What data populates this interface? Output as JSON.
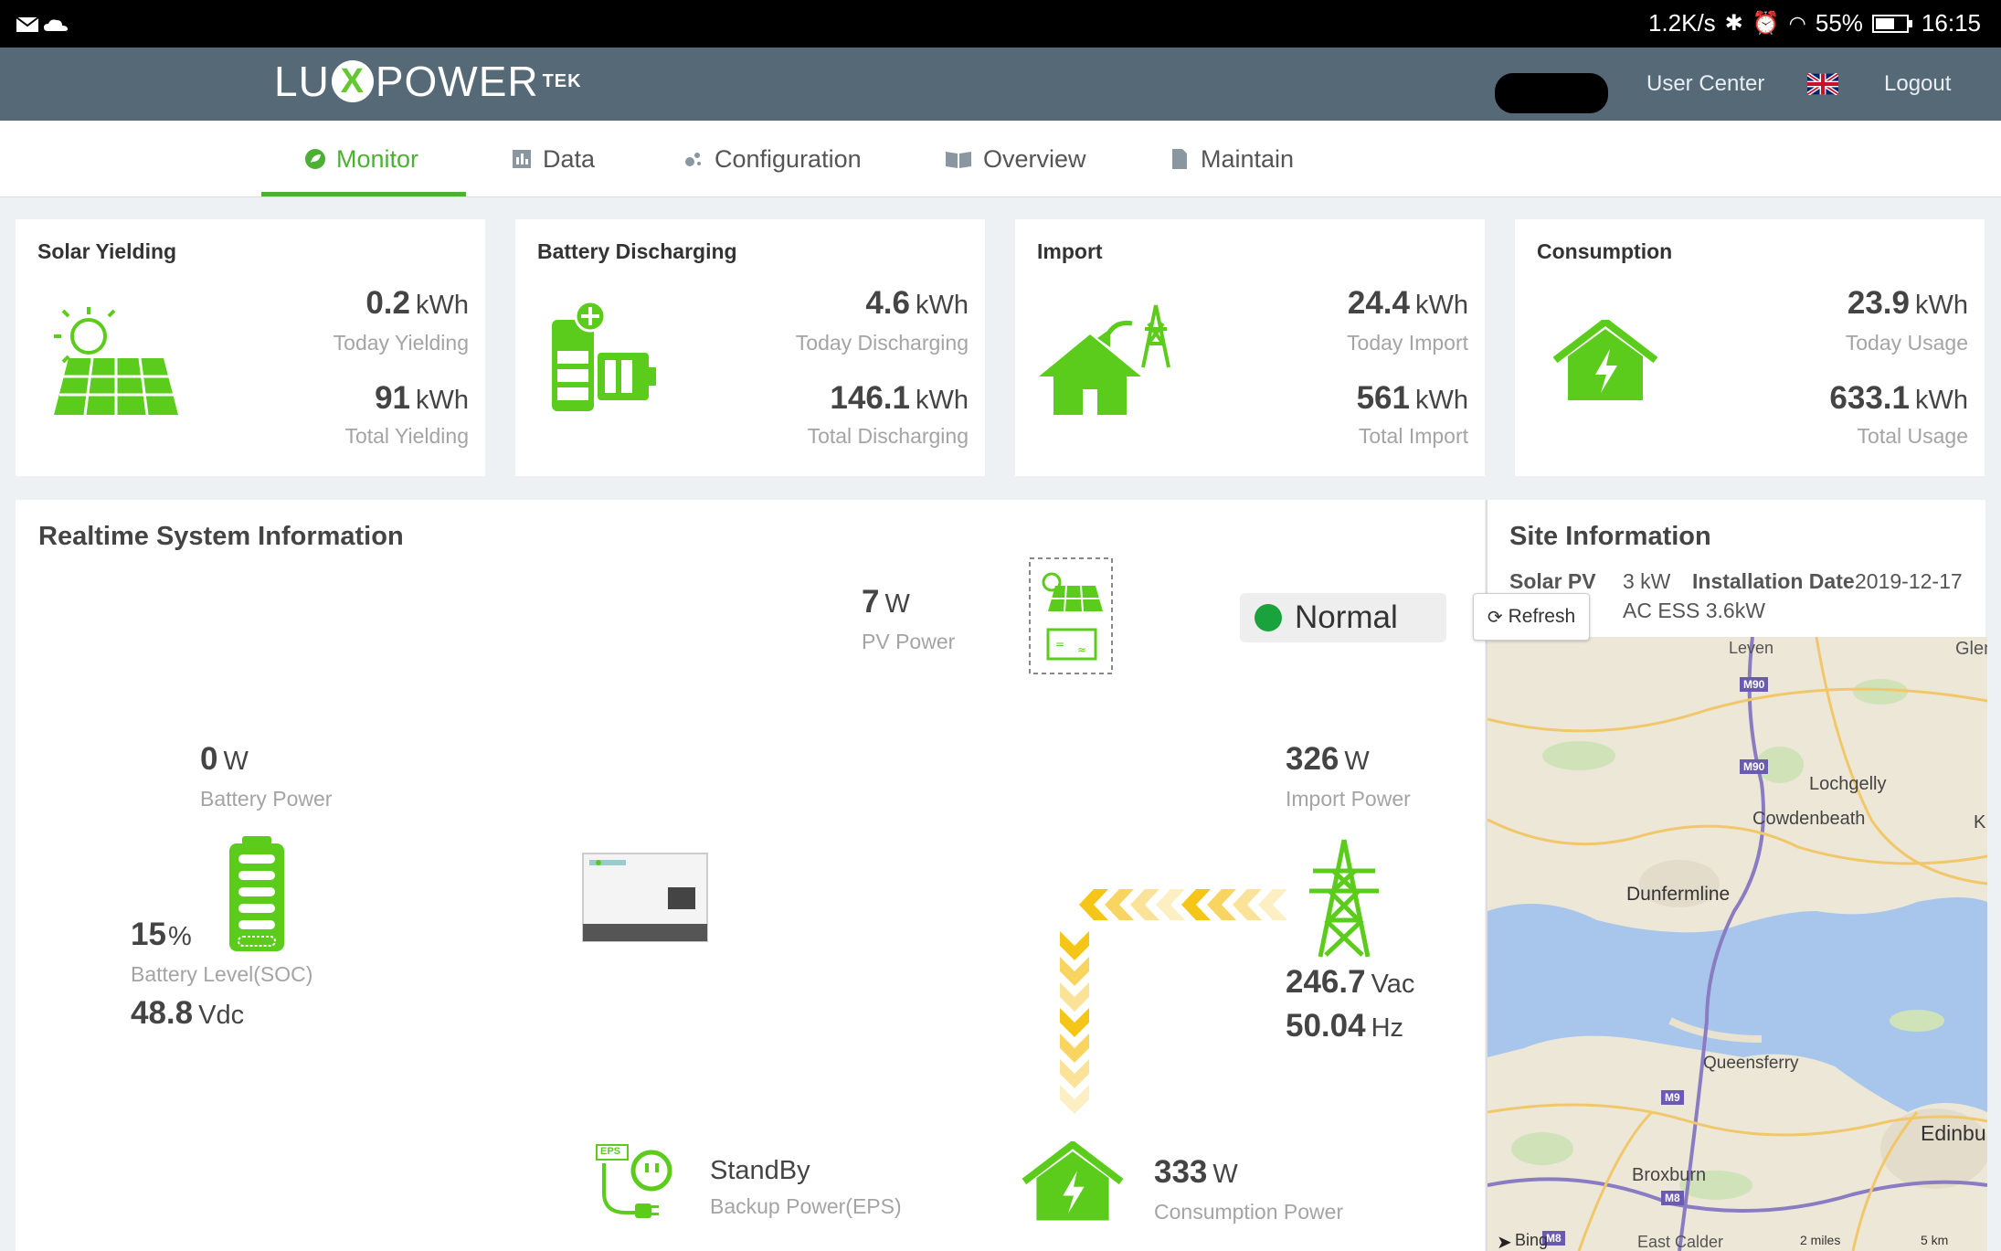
{
  "status_bar": {
    "speed": "1.2K/s",
    "battery": "55%",
    "time": "16:15"
  },
  "header": {
    "logo_lu": "LU",
    "logo_x": "X",
    "logo_power": "POWER",
    "logo_tek": "TEK",
    "user_center": "User Center",
    "logout": "Logout"
  },
  "nav": {
    "tabs": [
      {
        "label": "Monitor"
      },
      {
        "label": "Data"
      },
      {
        "label": "Configuration"
      },
      {
        "label": "Overview"
      },
      {
        "label": "Maintain"
      }
    ]
  },
  "cards": [
    {
      "title": "Solar Yielding",
      "today_value": "0.2",
      "today_unit": "kWh",
      "today_label": "Today Yielding",
      "total_value": "91",
      "total_unit": "kWh",
      "total_label": "Total Yielding"
    },
    {
      "title": "Battery Discharging",
      "today_value": "4.6",
      "today_unit": "kWh",
      "today_label": "Today Discharging",
      "total_value": "146.1",
      "total_unit": "kWh",
      "total_label": "Total Discharging"
    },
    {
      "title": "Import",
      "today_value": "24.4",
      "today_unit": "kWh",
      "today_label": "Today Import",
      "total_value": "561",
      "total_unit": "kWh",
      "total_label": "Total Import"
    },
    {
      "title": "Consumption",
      "today_value": "23.9",
      "today_unit": "kWh",
      "today_label": "Today Usage",
      "total_value": "633.1",
      "total_unit": "kWh",
      "total_label": "Total Usage"
    }
  ],
  "realtime": {
    "title": "Realtime System Information",
    "pv_value": "7",
    "pv_unit": "W",
    "pv_label": "PV Power",
    "status": "Normal",
    "battery_value": "0",
    "battery_unit": "W",
    "battery_label": "Battery Power",
    "soc_value": "15",
    "soc_unit": "%",
    "soc_label": "Battery Level(SOC)",
    "battery_voltage": "48.8",
    "battery_voltage_unit": "Vdc",
    "import_value": "326",
    "import_unit": "W",
    "import_label": "Import Power",
    "grid_voltage": "246.7",
    "grid_voltage_unit": "Vac",
    "grid_freq": "50.04",
    "grid_freq_unit": "Hz",
    "eps_status": "StandBy",
    "eps_label": "Backup Power(EPS)",
    "eps_badge": "EPS",
    "consumption_value": "333",
    "consumption_unit": "W",
    "consumption_label": "Consumption Power"
  },
  "site": {
    "title": "Site Information",
    "solar_pv_label": "Solar PV",
    "solar_pv_value": "3 kW",
    "install_label": "Installation Date",
    "install_value": "2019-12-17",
    "ac_ess": "AC ESS 3.6kW",
    "refresh": "Refresh"
  },
  "map": {
    "places": [
      "Leven",
      "Glen",
      "Lochgelly",
      "Cowdenbeath",
      "Dunfermline",
      "Queensferry",
      "Edinbu",
      "Broxburn",
      "K",
      "East Calder",
      "Bing"
    ],
    "roads": [
      "M90",
      "M90",
      "M9",
      "M8",
      "M8"
    ],
    "scale_miles": "2 miles",
    "scale_km": "5 km"
  },
  "colors": {
    "green": "#4cb034",
    "header": "#566977",
    "flow": "#f5c518"
  }
}
